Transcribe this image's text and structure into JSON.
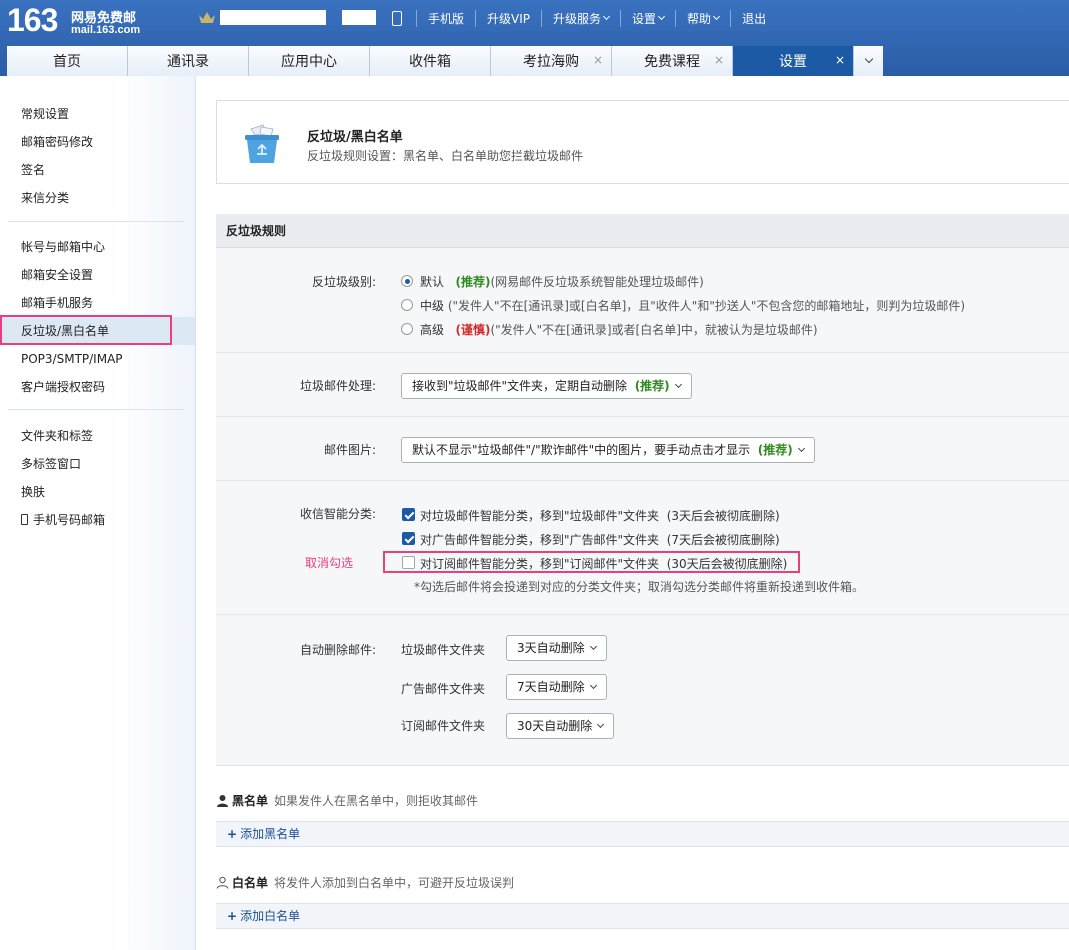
{
  "header": {
    "logo_num": "163",
    "logo_cn": "网易免费邮",
    "logo_url": "mail.163.com",
    "nav": [
      "手机版",
      "升级VIP",
      "升级服务",
      "设置",
      "帮助",
      "退出"
    ]
  },
  "tabs": [
    {
      "label": "首页",
      "closable": false
    },
    {
      "label": "通讯录",
      "closable": false
    },
    {
      "label": "应用中心",
      "closable": false
    },
    {
      "label": "收件箱",
      "closable": false
    },
    {
      "label": "考拉海购",
      "closable": true
    },
    {
      "label": "免费课程",
      "closable": true
    },
    {
      "label": "设置",
      "closable": true,
      "active": true
    }
  ],
  "tab_close_glyph": "×",
  "sidebar": {
    "group1": [
      "常规设置",
      "邮箱密码修改",
      "签名",
      "来信分类"
    ],
    "group2": [
      "帐号与邮箱中心",
      "邮箱安全设置",
      "邮箱手机服务",
      "反垃圾/黑白名单",
      "POP3/SMTP/IMAP",
      "客户端授权密码"
    ],
    "group3": [
      "文件夹和标签",
      "多标签窗口",
      "换肤",
      "手机号码邮箱"
    ]
  },
  "panel": {
    "title": "反垃圾/黑白名单",
    "subtitle": "反垃圾规则设置：黑名单、白名单助您拦截垃圾邮件"
  },
  "rules": {
    "heading": "反垃圾规则",
    "level": {
      "label": "反垃圾级别:",
      "options": [
        {
          "name": "默认",
          "tag": "(推荐)",
          "desc": "(网易邮件反垃圾系统智能处理垃圾邮件)",
          "selected": true
        },
        {
          "name": "中级",
          "tag": "",
          "desc": "(\"发件人\"不在[通讯录]或[白名单]，且\"收件人\"和\"抄送人\"不包含您的邮箱地址，则判为垃圾邮件)",
          "selected": false
        },
        {
          "name": "高级",
          "tag": "(谨慎)",
          "desc": "(\"发件人\"不在[通讯录]或者[白名单]中，就被认为是垃圾邮件)",
          "selected": false
        }
      ]
    },
    "spam_handling": {
      "label": "垃圾邮件处理:",
      "value": "接收到\"垃圾邮件\"文件夹，定期自动删除",
      "tag": "(推荐)"
    },
    "images": {
      "label": "邮件图片:",
      "value": "默认不显示\"垃圾邮件\"/\"欺诈邮件\"中的图片，要手动点击才显示",
      "tag": "(推荐)"
    },
    "smart": {
      "label": "收信智能分类:",
      "items": [
        {
          "text": "对垃圾邮件智能分类，移到\"垃圾邮件\"文件夹",
          "note": "(3天后会被彻底删除)",
          "checked": true
        },
        {
          "text": "对广告邮件智能分类，移到\"广告邮件\"文件夹",
          "note": "(7天后会被彻底删除)",
          "checked": true
        },
        {
          "text": "对订阅邮件智能分类，移到\"订阅邮件\"文件夹",
          "note": "(30天后会被彻底删除)",
          "checked": false
        }
      ],
      "hint": "*勾选后邮件将会投递到对应的分类文件夹；取消勾选分类邮件将重新投递到收件箱。",
      "annotation": "取消勾选"
    },
    "auto_delete": {
      "label": "自动删除邮件:",
      "folders": [
        {
          "name": "垃圾邮件文件夹",
          "value": "3天自动删除"
        },
        {
          "name": "广告邮件文件夹",
          "value": "7天自动删除"
        },
        {
          "name": "订阅邮件文件夹",
          "value": "30天自动删除"
        }
      ]
    }
  },
  "blacklist": {
    "title": "黑名单",
    "desc": "如果发件人在黑名单中，则拒收其邮件",
    "add": "添加黑名单"
  },
  "whitelist": {
    "title": "白名单",
    "desc": "将发件人添加到白名单中，可避开反垃圾误判",
    "add": "添加白名单"
  },
  "add_glyph": "+"
}
